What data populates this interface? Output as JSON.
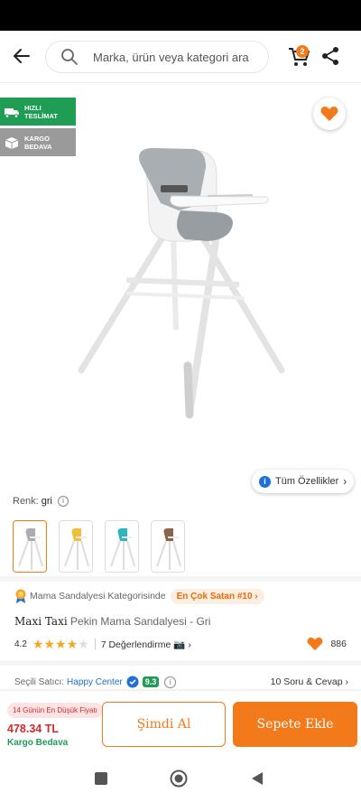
{
  "search": {
    "placeholder": "Marka, ürün veya kategori ara"
  },
  "cart": {
    "count": "2"
  },
  "badges": [
    {
      "line1": "HIZLI",
      "line2": "TESLİMAT",
      "icon": "truck-icon"
    },
    {
      "line1": "KARGO",
      "line2": "BEDAVA",
      "icon": "box-icon"
    }
  ],
  "all_specs": {
    "label": "Tüm Özellikler"
  },
  "color": {
    "label": "Renk:",
    "value": "gri"
  },
  "category": {
    "label": "Mama Sandalyesi Kategorisinde",
    "best": "En Çok Satan #10"
  },
  "product": {
    "brand": "Maxi Taxi",
    "name": "Pekin Mama Sandalyesi - Gri"
  },
  "rating": {
    "score": "4.2",
    "stars_filled": 4,
    "stars_total": 5,
    "reviews": "7 Değerlendirme",
    "favorites": "886"
  },
  "seller": {
    "label": "Seçili Satıcı:",
    "name": "Happy Center",
    "score": "9.3",
    "qa": "10 Soru & Cevap"
  },
  "buy": {
    "low_price": "14 Günün En Düşük Fiyatı",
    "price": "478.34 TL",
    "shipping": "Kargo Bedava",
    "buy_now": "Şimdi Al",
    "add_to_cart": "Sepete Ekle"
  },
  "colors": {
    "accent": "#f27a1a",
    "green": "#1f9d55",
    "price_red": "#d12a2a",
    "link_blue": "#1e6fd9"
  }
}
